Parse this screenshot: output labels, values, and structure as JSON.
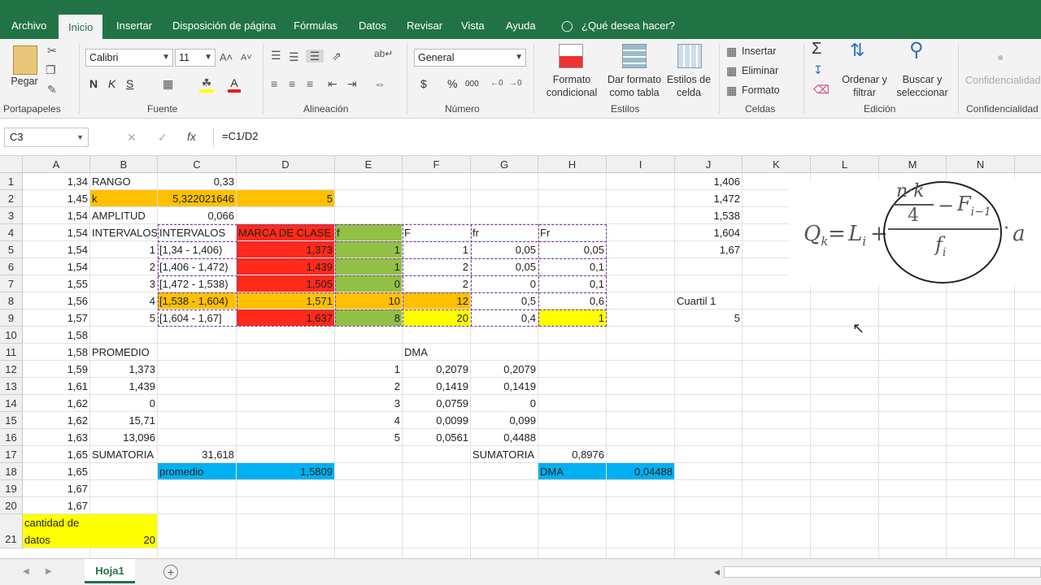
{
  "ribbon_tabs": [
    "Archivo",
    "Inicio",
    "Insertar",
    "Disposición de página",
    "Fórmulas",
    "Datos",
    "Revisar",
    "Vista",
    "Ayuda",
    "¿Qué desea hacer?"
  ],
  "clipboard": {
    "paste": "Pegar",
    "group": "Portapapeles"
  },
  "font": {
    "name": "Calibri",
    "size": "11",
    "bold": "N",
    "italic": "K",
    "underline": "S",
    "group": "Fuente"
  },
  "alignment": {
    "group": "Alineación"
  },
  "number": {
    "format": "General",
    "currency": "$",
    "percent": "%",
    "thousands": "000",
    "group": "Número"
  },
  "styles": {
    "cond_format": [
      "Formato",
      "condicional"
    ],
    "format_table": [
      "Dar formato",
      "como tabla"
    ],
    "cell_styles": [
      "Estilos de",
      "celda"
    ],
    "group": "Estilos"
  },
  "cells": {
    "insert": "Insertar",
    "delete": "Eliminar",
    "format": "Formato",
    "group": "Celdas"
  },
  "editing": {
    "sort": [
      "Ordenar y",
      "filtrar"
    ],
    "find": [
      "Buscar y",
      "seleccionar"
    ],
    "group": "Edición"
  },
  "confidential": {
    "label": "Confidencialidad",
    "group": "Confidencialidad"
  },
  "formula_bar": {
    "name_box": "C3",
    "formula": "=C1/D2",
    "fx": "fx"
  },
  "columns": [
    "A",
    "B",
    "C",
    "D",
    "E",
    "F",
    "G",
    "H",
    "I",
    "J",
    "K",
    "L",
    "M",
    "N"
  ],
  "rows": [
    "1",
    "2",
    "3",
    "4",
    "5",
    "6",
    "7",
    "8",
    "9",
    "10",
    "11",
    "12",
    "13",
    "14",
    "15",
    "16",
    "17",
    "18",
    "19",
    "20",
    "21"
  ],
  "cells_data": {
    "A": [
      "1,34",
      "1,45",
      "1,54",
      "1,54",
      "1,54",
      "1,54",
      "1,55",
      "1,56",
      "1,57",
      "1,58",
      "1,58",
      "1,59",
      "1,61",
      "1,62",
      "1,62",
      "1,63",
      "1,65",
      "1,65",
      "1,67",
      "1,67",
      "20"
    ],
    "B1": "RANGO",
    "B2": "k",
    "B3": "AMPLITUD",
    "B4": "INTERVALOS",
    "B5": "1",
    "B6": "2",
    "B7": "3",
    "B8": "4",
    "B9": "5",
    "B11": "PROMEDIO",
    "B12": "1,373",
    "B13": "1,439",
    "B14": "0",
    "B15": "15,71",
    "B16": "13,096",
    "B17": "SUMATORIA",
    "C1": "0,33",
    "C2": "5,322021646",
    "C3": "0,066",
    "C4": "INTERVALOS",
    "C5": "[1,34 - 1,406)",
    "C6": "[1,406 - 1,472)",
    "C7": "[1,472 - 1,538)",
    "C8": "[1,538 - 1,604)",
    "C9": "[1,604 - 1,67]",
    "C17": "31,618",
    "C18": "promedio",
    "D2": "5",
    "D4": "MARCA DE CLASE",
    "D5": "1,373",
    "D6": "1,439",
    "D7": "1,505",
    "D8": "1,571",
    "D9": "1,637",
    "D18": "1,5809",
    "E4": "f",
    "E5": "1",
    "E6": "1",
    "E7": "0",
    "E8": "10",
    "E9": "8",
    "E12": "1",
    "E13": "2",
    "E14": "3",
    "E15": "4",
    "E16": "5",
    "F4": "F",
    "F5": "1",
    "F6": "2",
    "F7": "2",
    "F8": "12",
    "F9": "20",
    "F11": "DMA",
    "F12": "0,2079",
    "F13": "0,1419",
    "F14": "0,0759",
    "F15": "0,0099",
    "F16": "0,0561",
    "G4": "fr",
    "G5": "0,05",
    "G6": "0,05",
    "G7": "0",
    "G8": "0,5",
    "G9": "0,4",
    "G12": "0,2079",
    "G13": "0,1419",
    "G14": "0",
    "G15": "0,099",
    "G16": "0,4488",
    "G17": "SUMATORIA",
    "H4": "Fr",
    "H5": "0,05",
    "H6": "0,1",
    "H7": "0,1",
    "H8": "0,6",
    "H9": "1",
    "H17": "0,8976",
    "H18": "DMA",
    "I18": "0,04488",
    "J1": "1,406",
    "J2": "1,472",
    "J3": "1,538",
    "J4": "1,604",
    "J5": "1,67",
    "J8": "Cuartil 1",
    "J9": "5",
    "A20b": "cantidad de",
    "A21b": "datos"
  },
  "formula_image": {
    "lhs": "Q",
    "lhs_sub": "k",
    "eq": "=",
    "L": "L",
    "L_sub": "i",
    "plus": "+",
    "num_a": "n·k",
    "num_b": "4",
    "minus": "−",
    "F": "F",
    "F_sub": "i−1",
    "den": "f",
    "den_sub": "i",
    "tail": "a"
  },
  "sheet_tab": "Hoja1",
  "colors": {
    "excel_green": "#217346",
    "orange": "#FFC000",
    "red": "#FF2A1A",
    "green": "#92C047",
    "yellow": "#FFFF00",
    "blue": "#00B0F0"
  }
}
